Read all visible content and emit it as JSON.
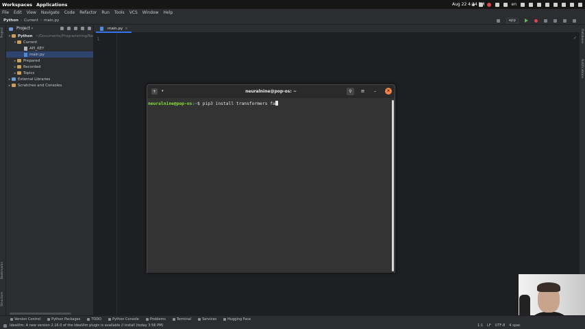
{
  "topbar": {
    "workspaces": "Workspaces",
    "applications": "Applications",
    "clock": "Aug 22  4:34 PM",
    "lang": "en"
  },
  "menu": [
    "File",
    "Edit",
    "View",
    "Navigate",
    "Code",
    "Refactor",
    "Run",
    "Tools",
    "VCS",
    "Window",
    "Help"
  ],
  "breadcrumb": {
    "project": "Python",
    "folder": "Current",
    "file": "main.py"
  },
  "run_config": "app",
  "project_panel": {
    "title": "Project",
    "root": "Python",
    "root_path": "~/Documents/Programming/Ne",
    "items": [
      "Current",
      "API_KEY",
      "main.py",
      "Prepared",
      "Recorded",
      "Topics",
      "External Libraries",
      "Scratches and Consoles"
    ]
  },
  "editor": {
    "tab": "main.py",
    "line_number": "1"
  },
  "terminal": {
    "title": "neuralnine@pop-os: ~",
    "user_host": "neuralnine@pop-os",
    "path": ":~",
    "dollar": "$",
    "command": " pip3 install transformers fa"
  },
  "left_strip": {
    "project_label": "Project",
    "bookmarks_label": "Bookmarks",
    "structure_label": "Structure"
  },
  "right_strip": {
    "database_label": "Database",
    "notifications_label": "Notifications"
  },
  "bottom_tools": [
    "Version Control",
    "Python Packages",
    "TODO",
    "Python Console",
    "Problems",
    "Terminal",
    "Services",
    "Hugging Face"
  ],
  "status": {
    "message": "IdeaVim: A new version 2.16.0 of the IdeaVim plugin is available // Install (today 3:56 PM)",
    "position": "1:1",
    "line_sep": "LF",
    "encoding": "UTF-8",
    "indent": "4 spac"
  },
  "colors": {
    "accent": "#3574f0",
    "prompt_user": "#8ae234",
    "prompt_path": "#729fcf",
    "close_button": "#f0844a"
  }
}
